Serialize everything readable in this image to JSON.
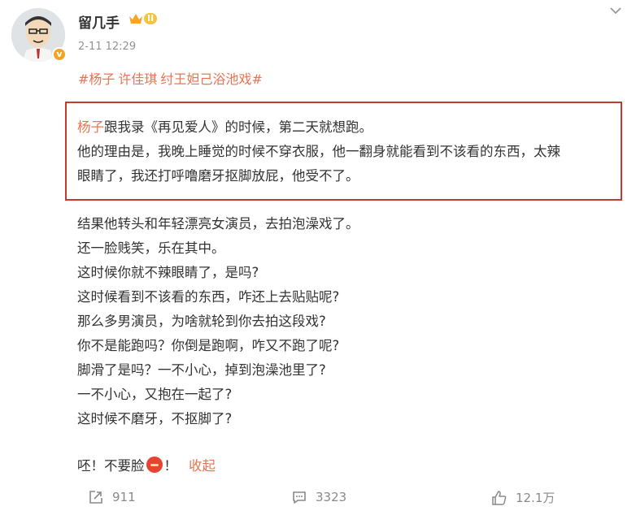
{
  "user": {
    "name": "留几手",
    "vip_label": "II",
    "verified_mark": "v",
    "timestamp": "2-11 12:29"
  },
  "tags": [
    "#杨子",
    "许佳琪",
    "纣王妲己浴池戏#"
  ],
  "highlight": {
    "mention": "杨子",
    "line1_rest": "跟我录《再见爱人》的时候，第二天就想跑。",
    "line2": "他的理由是，我晚上睡觉的时候不穿衣服，他一翻身就能看到不该看的东西，太辣",
    "line3": "眼睛了，我还打呼噜磨牙抠脚放屁，他受不了。"
  },
  "body_lines": [
    "结果他转头和年轻漂亮女演员，去拍泡澡戏了。",
    "还一脸贱笑，乐在其中。",
    "这时候你就不辣眼睛了，是吗?",
    "这时候看到不该看的东西，咋还上去贴贴呢?",
    "那么多男演员，为啥就轮到你去拍这段戏?",
    "你不是能跑吗？你倒是跑啊，咋又不跑了呢?",
    "脚滑了是吗？一不小心，掉到泡澡池里了?",
    "一不小心，又抱在一起了?",
    "这时候不磨牙，不抠脚了?"
  ],
  "closing": {
    "text_before": "呸！不要脸",
    "text_after": "！",
    "collapse": "收起"
  },
  "footer": {
    "share": "911",
    "comments": "3323",
    "likes": "12.1万"
  },
  "icons": {
    "avatar": "cartoon-avatar",
    "vip": "crown-icon",
    "more": "chevron-down-icon",
    "share": "share-icon",
    "comment": "comment-icon",
    "like": "thumbs-up-icon",
    "emoji": "angry-face-emoji"
  },
  "colors": {
    "accent": "#eb7350",
    "highlight_border": "#c43a30",
    "meta": "#939393"
  }
}
